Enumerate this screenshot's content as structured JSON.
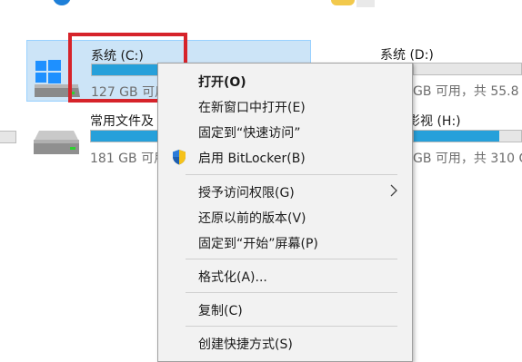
{
  "drives": {
    "c": {
      "name": "系统 (C:)",
      "space": "127 GB 可用",
      "fill_percent": 45
    },
    "d": {
      "name": "系统 (D:)",
      "space": "GB 可用，共 55.8"
    },
    "common": {
      "name": "常用文件及",
      "space": "181 GB 可用",
      "fill_percent": 78
    },
    "h": {
      "name": "影视 (H:)",
      "space": "GB 可用，共 310 G"
    }
  },
  "context_menu": {
    "items": [
      {
        "label": "打开(O)",
        "bold": true
      },
      {
        "label": "在新窗口中打开(E)"
      },
      {
        "label": "固定到“快速访问”"
      },
      {
        "label": "启用 BitLocker(B)",
        "icon": "uac-shield-icon"
      },
      {
        "label": "授予访问权限(G)",
        "submenu": true
      },
      {
        "label": "还原以前的版本(V)"
      },
      {
        "label": "固定到“开始”屏幕(P)"
      },
      {
        "label": "格式化(A)..."
      },
      {
        "label": "复制(C)"
      },
      {
        "label": "创建快捷方式(S)"
      }
    ]
  },
  "colors": {
    "accent": "#26a0da",
    "highlight_box": "#d6232a",
    "selection": "#cce4f7"
  }
}
